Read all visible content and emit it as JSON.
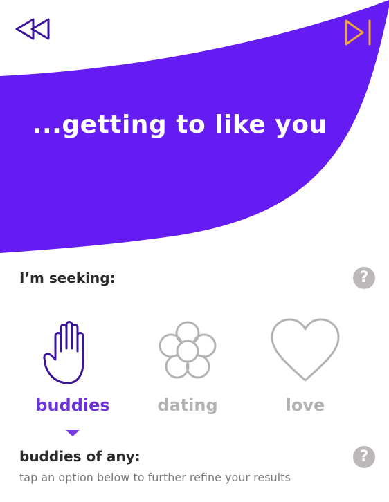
{
  "header": {
    "title": "...getting to like you...",
    "back_icon": "rewind-icon",
    "skip_icon": "skip-forward-icon"
  },
  "seeking": {
    "label": "I’m seeking:",
    "help": "?"
  },
  "options": [
    {
      "label": "buddies",
      "icon": "hand-icon",
      "selected": true
    },
    {
      "label": "dating",
      "icon": "flower-icon",
      "selected": false
    },
    {
      "label": "love",
      "icon": "heart-icon",
      "selected": false
    }
  ],
  "refine": {
    "label": "buddies of any:",
    "hint": "tap an option below to further refine your results",
    "help": "?"
  },
  "colors": {
    "accent": "#651cf3",
    "selected_text": "#6c33d6",
    "unselected": "#b3b3b3",
    "skip_icon": "#f0a537",
    "help_bg": "#bcb8b8"
  }
}
